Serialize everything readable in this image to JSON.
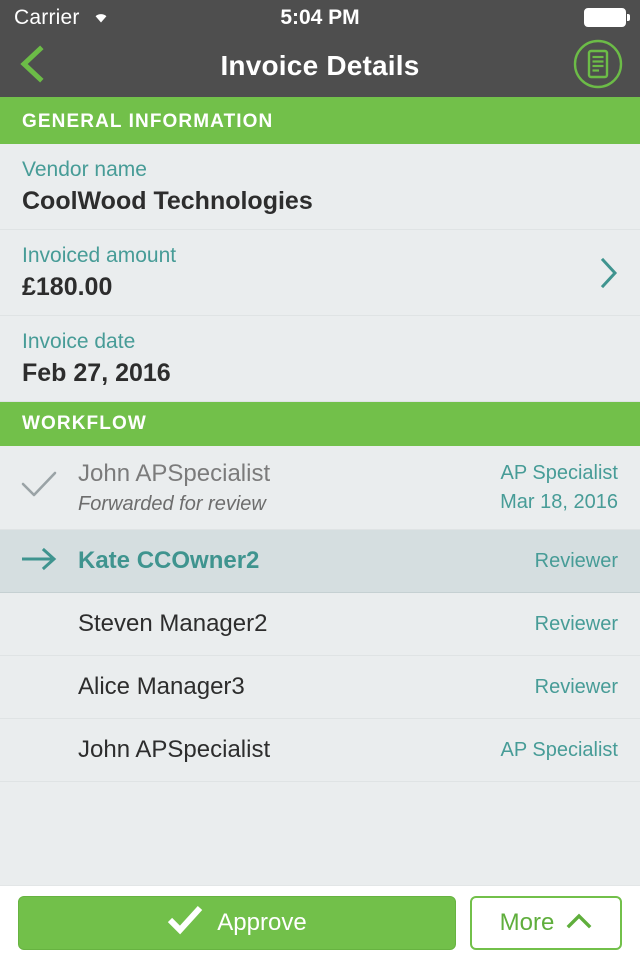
{
  "status_bar": {
    "carrier": "Carrier",
    "wifi_icon": "wifi-icon",
    "time": "5:04 PM",
    "battery_icon": "battery-full-icon"
  },
  "nav": {
    "back_icon": "chevron-left-icon",
    "title": "Invoice Details",
    "action_icon": "document-circle-icon"
  },
  "general_information": {
    "header": "GENERAL INFORMATION",
    "rows": [
      {
        "label": "Vendor name",
        "value": "CoolWood Technologies",
        "chevron": false
      },
      {
        "label": "Invoiced amount",
        "value": "£180.00",
        "chevron": true
      },
      {
        "label": "Invoice date",
        "value": "Feb 27, 2016",
        "chevron": false
      }
    ]
  },
  "workflow": {
    "header": "WORKFLOW",
    "rows": [
      {
        "state": "done",
        "icon": "check-icon",
        "name": "John APSpecialist",
        "subtitle": "Forwarded for review",
        "role": "AP Specialist",
        "date": "Mar 18, 2016"
      },
      {
        "state": "current",
        "icon": "arrow-right-icon",
        "name": "Kate CCOwner2",
        "subtitle": "",
        "role": "Reviewer",
        "date": ""
      },
      {
        "state": "pending",
        "icon": "",
        "name": "Steven Manager2",
        "subtitle": "",
        "role": "Reviewer",
        "date": ""
      },
      {
        "state": "pending",
        "icon": "",
        "name": "Alice Manager3",
        "subtitle": "",
        "role": "Reviewer",
        "date": ""
      },
      {
        "state": "pending",
        "icon": "",
        "name": "John APSpecialist",
        "subtitle": "",
        "role": "AP Specialist",
        "date": ""
      }
    ]
  },
  "actions": {
    "approve_label": "Approve",
    "approve_icon": "check-icon",
    "more_label": "More",
    "more_icon": "chevron-up-icon"
  },
  "colors": {
    "green": "#72c04a",
    "teal": "#479c97",
    "nav_gray": "#4e4e4e",
    "row_bg": "#eaedee",
    "row_current_bg": "#d5dee0"
  }
}
